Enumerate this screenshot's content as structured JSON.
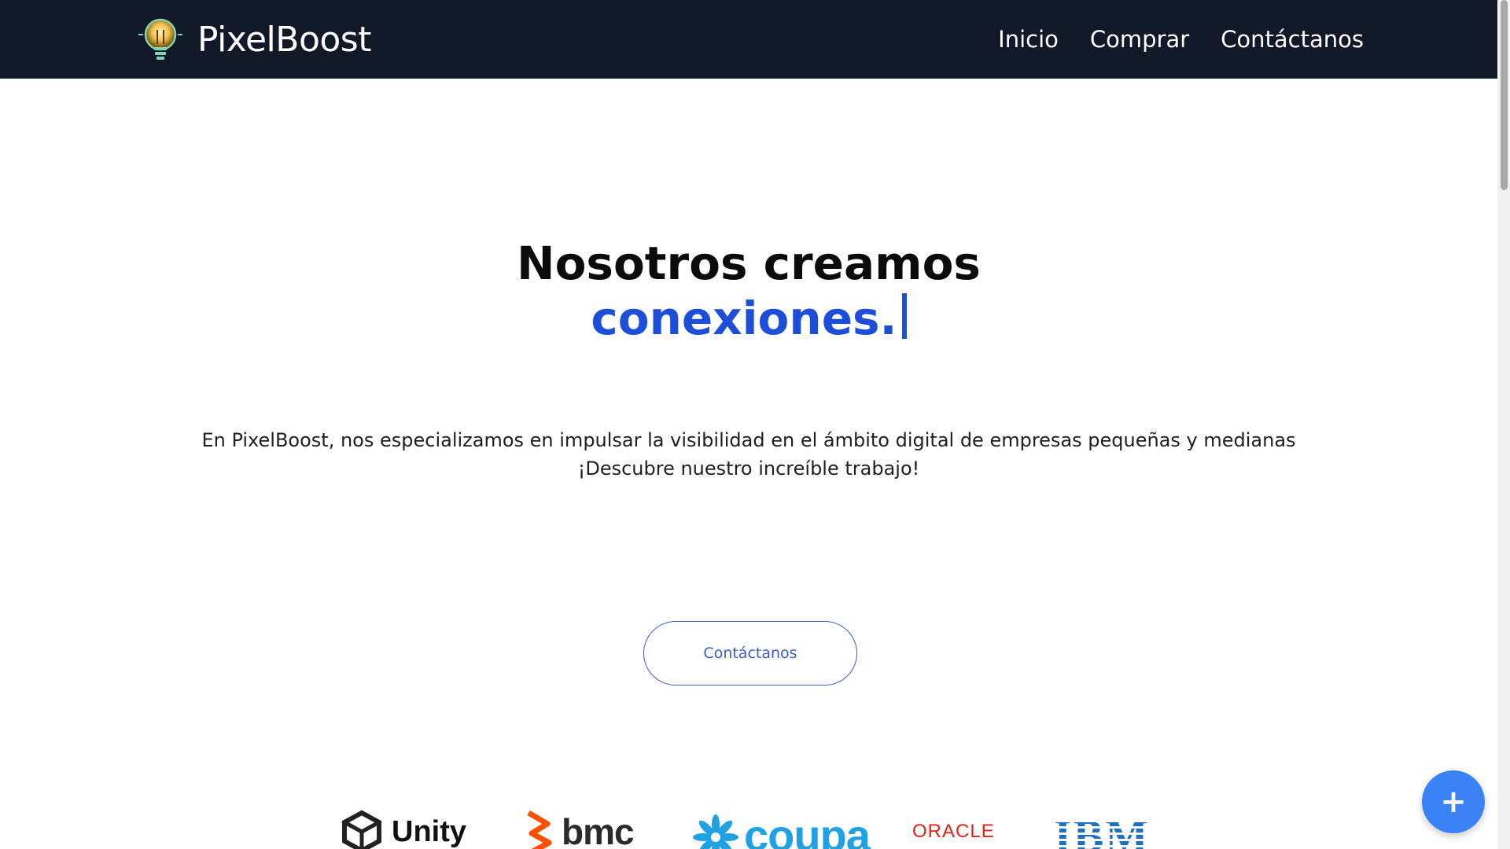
{
  "brand": {
    "name": "PixelBoost",
    "logo_icon": "lightbulb-icon"
  },
  "nav": {
    "items": [
      {
        "label": "Inicio"
      },
      {
        "label": "Comprar"
      },
      {
        "label": "Contáctanos"
      }
    ]
  },
  "hero": {
    "title_line1": "Nosotros creamos",
    "title_line2": "conexiones.",
    "description_line1": "En PixelBoost, nos especializamos en impulsar la visibilidad en el ámbito digital de empresas pequeñas y medianas",
    "description_line2": "¡Descubre nuestro increíble trabajo!",
    "cta_label": "Contáctanos"
  },
  "client_logos": [
    {
      "name": "Unity",
      "icon": "unity-logo-icon",
      "color": "#111111"
    },
    {
      "name": "bmc",
      "icon": "bmc-logo-icon",
      "color": "#fe5000"
    },
    {
      "name": "coupa",
      "icon": "coupa-logo-icon",
      "color": "#1fa2e4"
    },
    {
      "name": "ORACLE",
      "icon": "oracle-logo-icon",
      "color": "#e2231a"
    },
    {
      "name": "IBM",
      "icon": "ibm-logo-icon",
      "color": "#1f70c1"
    }
  ],
  "fab": {
    "label": "+",
    "icon": "plus-icon",
    "color": "#3b82f6"
  },
  "colors": {
    "navbar_bg": "#111827",
    "accent_blue": "#1d4ed8",
    "button_border": "#3b5fc0"
  }
}
